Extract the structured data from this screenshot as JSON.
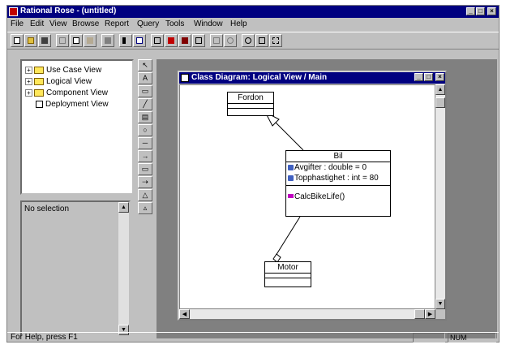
{
  "app": {
    "title": "Rational Rose - (untitled)"
  },
  "menu": [
    "File",
    "Edit",
    "View",
    "Browse",
    "Report",
    "Query",
    "Tools",
    "Window",
    "Help"
  ],
  "toolbar": {
    "buttons": [
      "new-icon",
      "open-icon",
      "save-icon",
      "cut-icon",
      "copy-icon",
      "paste-icon",
      "print-icon",
      "context-help-icon",
      "documentation-icon",
      "browse-icon",
      "delete-icon",
      "undo-icon",
      "back-icon",
      "forward-icon",
      "zoom-in-icon",
      "zoom-out-icon",
      "fit-window-icon",
      "undo-fit-icon"
    ]
  },
  "browser": {
    "items": [
      {
        "label": "Use Case View",
        "icon": "folder-icon",
        "expandable": true
      },
      {
        "label": "Logical View",
        "icon": "folder-icon",
        "expandable": true
      },
      {
        "label": "Component View",
        "icon": "folder-icon",
        "expandable": true
      },
      {
        "label": "Deployment View",
        "icon": "deployment-icon",
        "expandable": false
      }
    ]
  },
  "documentation": {
    "text": "No selection"
  },
  "palette": {
    "tools": [
      "selection-arrow-icon",
      "text-box-icon",
      "note-icon",
      "anchor-note-icon",
      "class-icon",
      "interface-icon",
      "association-icon",
      "unidirectional-association-icon",
      "package-icon",
      "dependency-icon",
      "generalization-icon",
      "realize-icon"
    ]
  },
  "diagram": {
    "window_title": "Class Diagram: Logical View / Main",
    "classes": [
      {
        "name": "Fordon",
        "attributes": [],
        "operations": []
      },
      {
        "name": "Bil",
        "attributes": [
          "Avgifter : double = 0",
          "Topphastighet : int = 80"
        ],
        "operations": [
          "CalcBikeLife()"
        ]
      },
      {
        "name": "Motor",
        "attributes": [],
        "operations": []
      }
    ],
    "relations": [
      {
        "type": "generalization",
        "from": "Bil",
        "to": "Fordon"
      },
      {
        "type": "aggregation",
        "from": "Motor",
        "to": "Bil"
      }
    ]
  },
  "status": {
    "help": "For Help, press F1",
    "mode": "NUM"
  }
}
